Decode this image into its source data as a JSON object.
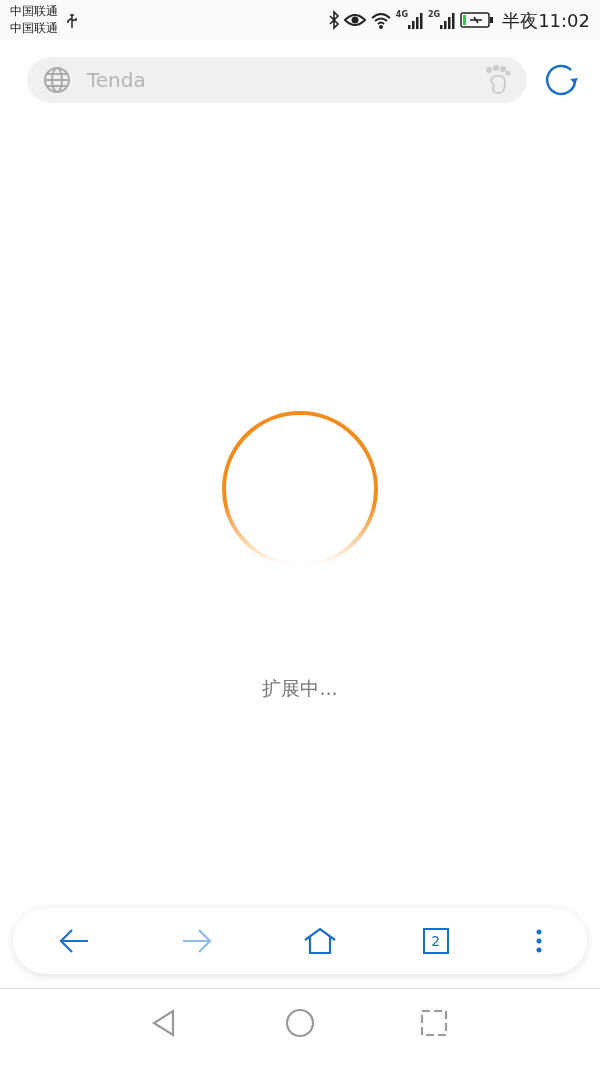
{
  "status_bar": {
    "carriers": [
      "中国联通",
      "中国联通"
    ],
    "network_labels": [
      "4G",
      "2G"
    ],
    "time": "半夜11:02"
  },
  "address_bar": {
    "text": "Tenda"
  },
  "loading": {
    "message": "扩展中..."
  },
  "toolbar": {
    "buttons": [
      {
        "kind": "back",
        "disabled": false
      },
      {
        "kind": "forward",
        "disabled": true
      },
      {
        "kind": "home",
        "disabled": false
      },
      {
        "kind": "tabs",
        "disabled": false,
        "count": "2"
      },
      {
        "kind": "menu",
        "disabled": false
      }
    ]
  },
  "nav_bar": {
    "buttons": [
      {
        "kind": "back"
      },
      {
        "kind": "home"
      },
      {
        "kind": "recents"
      }
    ]
  }
}
